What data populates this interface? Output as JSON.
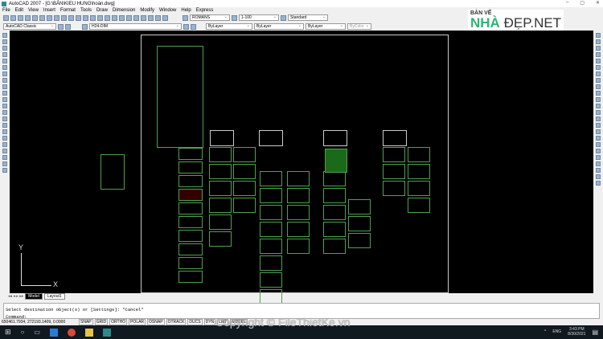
{
  "title": "AutoCAD 2007 - [G:\\BẢN\\KIEU HUNG\\hoàn.dwg]",
  "window_controls": [
    "–",
    "▢",
    "✕"
  ],
  "menu": [
    "File",
    "Edit",
    "View",
    "Insert",
    "Format",
    "Tools",
    "Draw",
    "Dimension",
    "Modify",
    "Window",
    "Help",
    "Express"
  ],
  "toolbar": {
    "text_style": "ROMANS",
    "dim_scale": "1-100",
    "table_style": "Standard",
    "workspace": "AutoCAD Classic",
    "layer": "H24-DIM",
    "color": "ByLayer",
    "linetype": "ByLayer",
    "lineweight": "ByLayer",
    "plotstyle": "ByColor"
  },
  "tabs": [
    "Model",
    "Layout1"
  ],
  "command": {
    "history": "Select destination object(s) or [Settings]: *Cancel*",
    "prompt": "Command:"
  },
  "status": {
    "coords": "650461.7934, 272193.1409, 0.0000",
    "toggles": [
      "SNAP",
      "GRID",
      "ORTHO",
      "POLAR",
      "OSNAP",
      "OTRACK",
      "DUCS",
      "DYN",
      "LWT",
      "MODEL"
    ]
  },
  "ucs": {
    "y": "Y",
    "x": "X"
  },
  "taskbar": {
    "lang": "ENG",
    "time": "3:43 PM",
    "date": "8/30/2021"
  },
  "watermark": {
    "line1": "BẢN VẼ",
    "nha": "NHÀ",
    "dep": "ĐẸP.NET"
  },
  "copyright": "Copyright © FileThietKe.vn"
}
